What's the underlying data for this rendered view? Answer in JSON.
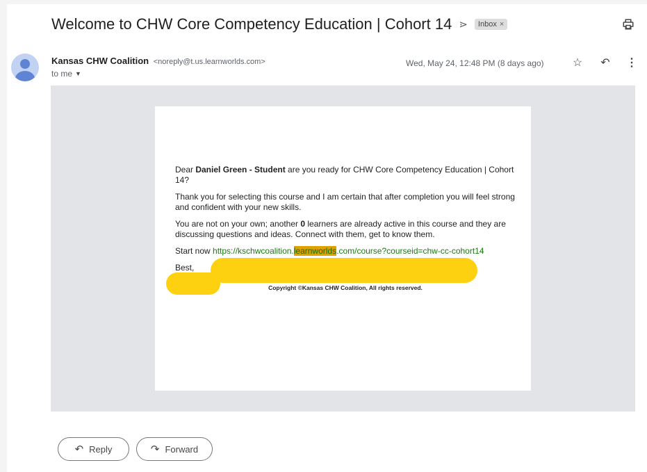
{
  "email": {
    "subject": "Welcome to CHW Core Competency Education | Cohort 14",
    "label": "Inbox",
    "label_close": "×",
    "sender_name": "Kansas CHW Coalition",
    "sender_email": "<noreply@t.us.learnworlds.com>",
    "recipient": "to me",
    "date": "Wed, May 24, 12:48 PM (8 days ago)"
  },
  "body": {
    "greeting_pre": "Dear ",
    "greeting_name": "Daniel Green - Student",
    "greeting_post": " are you ready for CHW Core Competency Education | Cohort 14?",
    "para2": "Thank you for selecting this course and I am certain that after completion you will feel strong and confident with your new skills.",
    "para3_pre": "You are not on your own; another ",
    "para3_count": "0",
    "para3_post": " learners are already active in this course and they are discussing questions and ideas. Connect with them, get to know them.",
    "start_pre": "Start now ",
    "link_part1": "https://kschwcoalition.",
    "link_part2": "learnworlds",
    "link_part3": ".com/course?courseid=chw-cc-cohort14",
    "closing": "Best,",
    "copyright": "Copyright ©Kansas CHW Coalition, All rights reserved."
  },
  "actions": {
    "reply": "Reply",
    "forward": "Forward"
  },
  "icons": {
    "important": "important-marker-icon",
    "print": "print-icon",
    "star": "star-icon",
    "reply": "reply-icon",
    "more": "more-vert-icon",
    "forward": "forward-icon"
  },
  "colors": {
    "highlight": "#fdd10f",
    "link": "#1a7a0f",
    "frame": "#e3e4e8"
  }
}
